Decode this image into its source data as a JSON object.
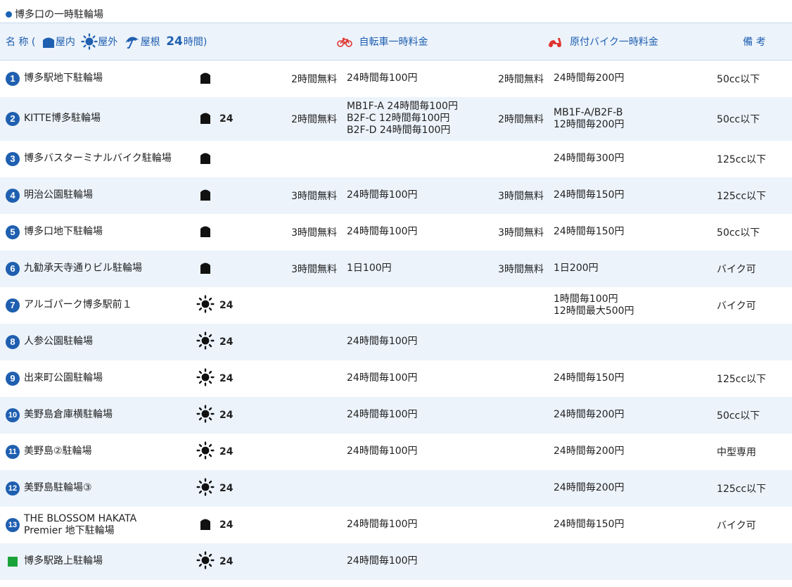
{
  "title": "博多口の一時駐輪場",
  "header": {
    "name_label": "名 称 (",
    "indoor_label": "屋内",
    "outdoor_label": "屋外",
    "roof_label": "屋根",
    "h24_label": "24",
    "h24_suffix": "時間)",
    "bicycle_fee_label": "自転車一時料金",
    "moped_fee_label": "原付バイク一時料金",
    "note_label": "備 考"
  },
  "icons": {
    "indoor": "building-icon",
    "outdoor": "sun-icon",
    "roof": "umbrella-icon",
    "bicycle": "bicycle-icon",
    "moped": "scooter-icon"
  },
  "colors": {
    "accent": "#1f5fb0",
    "row_alt": "#ecf3fb",
    "green_marker": "#1aa33a",
    "moped_icon": "#e0332f"
  },
  "rows": [
    {
      "num": "1",
      "name": [
        "博多駅地下駐輪場"
      ],
      "type": "indoor",
      "h24": "",
      "bike_free": "2時間無料",
      "bike_fee": [
        "24時間毎100円"
      ],
      "moto_free": "2時間無料",
      "moto_fee": [
        "24時間毎200円"
      ],
      "note": "50cc以下"
    },
    {
      "num": "2",
      "name": [
        "KITTE博多駐輪場"
      ],
      "type": "indoor",
      "h24": "24",
      "bike_free": "2時間無料",
      "bike_fee": [
        "MB1F-A 24時間毎100円",
        "B2F-C 12時間毎100円",
        "B2F-D 24時間毎100円"
      ],
      "moto_free": "2時間無料",
      "moto_fee": [
        "MB1F-A/B2F-B",
        "12時間毎200円"
      ],
      "note": "50cc以下"
    },
    {
      "num": "3",
      "name": [
        "博多バスターミナルバイク駐輪場"
      ],
      "type": "indoor",
      "h24": "",
      "bike_free": "",
      "bike_fee": [],
      "moto_free": "",
      "moto_fee": [
        "24時間毎300円"
      ],
      "note": "125cc以下"
    },
    {
      "num": "4",
      "name": [
        "明治公園駐輪場"
      ],
      "type": "indoor",
      "h24": "",
      "bike_free": "3時間無料",
      "bike_fee": [
        "24時間毎100円"
      ],
      "moto_free": "3時間無料",
      "moto_fee": [
        "24時間毎150円"
      ],
      "note": "125cc以下"
    },
    {
      "num": "5",
      "name": [
        "博多口地下駐輪場"
      ],
      "type": "indoor",
      "h24": "",
      "bike_free": "3時間無料",
      "bike_fee": [
        "24時間毎100円"
      ],
      "moto_free": "3時間無料",
      "moto_fee": [
        "24時間毎150円"
      ],
      "note": "50cc以下"
    },
    {
      "num": "6",
      "name": [
        "九勧承天寺通りビル駐輪場"
      ],
      "type": "indoor",
      "h24": "",
      "bike_free": "3時間無料",
      "bike_fee": [
        "1日100円"
      ],
      "moto_free": "3時間無料",
      "moto_fee": [
        "1日200円"
      ],
      "note": "バイク可"
    },
    {
      "num": "7",
      "name": [
        "アルゴパーク博多駅前１"
      ],
      "type": "outdoor",
      "h24": "24",
      "bike_free": "",
      "bike_fee": [],
      "moto_free": "",
      "moto_fee": [
        "1時間毎100円",
        "12時間最大500円"
      ],
      "note": "バイク可"
    },
    {
      "num": "8",
      "name": [
        "人参公園駐輪場"
      ],
      "type": "outdoor",
      "h24": "24",
      "bike_free": "",
      "bike_fee": [
        "24時間毎100円"
      ],
      "moto_free": "",
      "moto_fee": [],
      "note": ""
    },
    {
      "num": "9",
      "name": [
        "出来町公園駐輪場"
      ],
      "type": "outdoor",
      "h24": "24",
      "bike_free": "",
      "bike_fee": [
        "24時間毎100円"
      ],
      "moto_free": "",
      "moto_fee": [
        "24時間毎150円"
      ],
      "note": "125cc以下"
    },
    {
      "num": "10",
      "name": [
        "美野島倉庫横駐輪場"
      ],
      "type": "outdoor",
      "h24": "24",
      "bike_free": "",
      "bike_fee": [
        "24時間毎100円"
      ],
      "moto_free": "",
      "moto_fee": [
        "24時間毎200円"
      ],
      "note": "50cc以下"
    },
    {
      "num": "11",
      "name": [
        "美野島②駐輪場"
      ],
      "type": "outdoor",
      "h24": "24",
      "bike_free": "",
      "bike_fee": [
        "24時間毎100円"
      ],
      "moto_free": "",
      "moto_fee": [
        "24時間毎200円"
      ],
      "note": "中型専用"
    },
    {
      "num": "12",
      "name": [
        "美野島駐輪場③"
      ],
      "type": "outdoor",
      "h24": "24",
      "bike_free": "",
      "bike_fee": [],
      "moto_free": "",
      "moto_fee": [
        "24時間毎200円"
      ],
      "note": "125cc以下"
    },
    {
      "num": "13",
      "name": [
        "THE BLOSSOM HAKATA",
        "Premier 地下駐輪場"
      ],
      "type": "indoor",
      "h24": "24",
      "bike_free": "",
      "bike_fee": [
        "24時間毎100円"
      ],
      "moto_free": "",
      "moto_fee": [
        "24時間毎150円"
      ],
      "note": "バイク可"
    },
    {
      "num": "",
      "marker": "square",
      "name": [
        "博多駅路上駐輪場"
      ],
      "type": "outdoor",
      "h24": "24",
      "bike_free": "",
      "bike_fee": [
        "24時間毎100円"
      ],
      "moto_free": "",
      "moto_fee": [],
      "note": ""
    }
  ]
}
